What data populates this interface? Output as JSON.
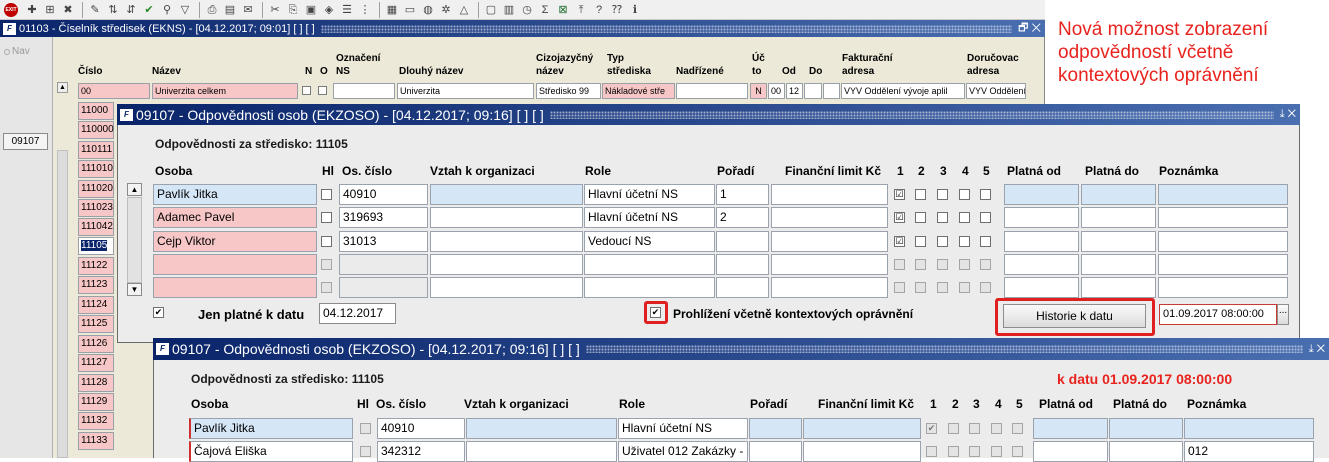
{
  "toolbar": {
    "exit_label": "EXIT",
    "icons": [
      "add-icon",
      "add-copy-icon",
      "delete-icon",
      "edit-icon",
      "sort-asc-icon",
      "sort-desc-icon",
      "confirm-icon",
      "filter-icon",
      "funnel-icon",
      "print-icon",
      "preview-icon",
      "mail-icon",
      "cut-icon",
      "copy-icon",
      "paste-icon",
      "select-icon",
      "list-icon",
      "tree-icon",
      "calculator-icon",
      "filter-form-icon",
      "web-icon",
      "settings-icon",
      "chart-icon",
      "mail-merge-icon",
      "calendar-icon",
      "clock-icon",
      "sum-icon",
      "excel-icon",
      "export-icon",
      "help-icon",
      "context-help-icon",
      "info-icon"
    ]
  },
  "main_window": {
    "title": "01103 - Číselník středisek (EKNS) - [04.12.2017; 09:01]  [ ]  [ ]",
    "controls": "🗗 ✕",
    "nav_label": "Nav",
    "nav_button": "09107",
    "columns": {
      "cislo": "Číslo",
      "nazev": "Název",
      "n": "N",
      "o": "O",
      "oznaceni": "Označení",
      "ns": "NS",
      "dlouhy": "Dlouhý název",
      "cizojazycny": "Cizojazyčný",
      "cizojazycny2": "název",
      "typ": "Typ",
      "typ2": "střediska",
      "nadrizene": "Nadřízené",
      "uc": "Úč",
      "uc2": "to",
      "od": "Od",
      "do": "Do",
      "fakturacni": "Fakturační",
      "fakturacni2": "adresa",
      "dorucovaci": "Doručovac",
      "dorucovaci2": "adresa"
    },
    "first_row": {
      "cislo": "00",
      "nazev": "Univerzita celkem",
      "dlouhy": "Univerzita",
      "cizojazycny": "Středisko 99",
      "typ": "Nákladové stře",
      "uc": "N",
      "od": "00",
      "do": "12",
      "fakturacni": "VYV Oddělení vývoje aplil",
      "dorucovaci": "VYV Oddělení"
    },
    "codes": [
      "11000",
      "110000",
      "110111",
      "111010",
      "111020",
      "111023",
      "111042",
      "11105",
      "11122",
      "11123",
      "11124",
      "11125",
      "11126",
      "11127",
      "11128",
      "11129",
      "11132",
      "11133"
    ],
    "selected_code": "11105"
  },
  "annotation": {
    "line1": "Nová možnost zobrazení",
    "line2": "odpovědností včetně",
    "line3": "kontextových oprávnění"
  },
  "dialog1": {
    "title": "09107 - Odpovědnosti osob (EKZOSO) - [04.12.2017; 09:16]  [ ]  [ ]",
    "controls": "⤓ ✕",
    "subtitle": "Odpovědnosti za středisko: 11105",
    "columns": {
      "osoba": "Osoba",
      "hl": "Hl",
      "os_cislo": "Os. číslo",
      "vztah": "Vztah k organizaci",
      "role": "Role",
      "poradi": "Pořadí",
      "limit": "Finanční limit Kč",
      "c1": "1",
      "c2": "2",
      "c3": "3",
      "c4": "4",
      "c5": "5",
      "platna_od": "Platná od",
      "platna_do": "Platná do",
      "poznamka": "Poznámka"
    },
    "rows": [
      {
        "osoba": "Pavlík Jitka",
        "os_cislo": "40910",
        "role": "Hlavní účetní NS",
        "poradi": "1",
        "c1": "☑"
      },
      {
        "osoba": "Adamec Pavel",
        "os_cislo": "319693",
        "role": "Hlavní účetní NS",
        "poradi": "2",
        "c1": "☑"
      },
      {
        "osoba": "Cejp Viktor",
        "os_cislo": "31013",
        "role": "Vedoucí NS",
        "poradi": "",
        "c1": "☑"
      }
    ],
    "only_valid_label": "Jen platné k datu",
    "only_valid_checked": "✔",
    "only_valid_date": "04.12.2017",
    "context_checked": "✔",
    "context_label": "Prohlížení včetně kontextových oprávnění",
    "history_button": "Historie k datu",
    "history_date": "01.09.2017 08:00:00",
    "history_ellipsis": "..."
  },
  "dialog2": {
    "title": "09107 - Odpovědnosti osob (EKZOSO) - [04.12.2017; 09:16]  [ ]  [ ]",
    "controls": "⤓ ✕",
    "subtitle": "Odpovědnosti za středisko: 11105",
    "as_of": "k datu 01.09.2017 08:00:00",
    "columns": {
      "osoba": "Osoba",
      "hl": "Hl",
      "os_cislo": "Os. číslo",
      "vztah": "Vztah k organizaci",
      "role": "Role",
      "poradi": "Pořadí",
      "limit": "Finanční limit Kč",
      "c1": "1",
      "c2": "2",
      "c3": "3",
      "c4": "4",
      "c5": "5",
      "platna_od": "Platná od",
      "platna_do": "Platná do",
      "poznamka": "Poznámka"
    },
    "rows": [
      {
        "osoba": "Pavlík Jitka",
        "os_cislo": "40910",
        "role": "Hlavní účetní NS",
        "poznamka": ""
      },
      {
        "osoba": "Čajová Eliška",
        "os_cislo": "342312",
        "role": "Uživatel 012 Zakázky -",
        "poznamka": "012"
      }
    ]
  }
}
